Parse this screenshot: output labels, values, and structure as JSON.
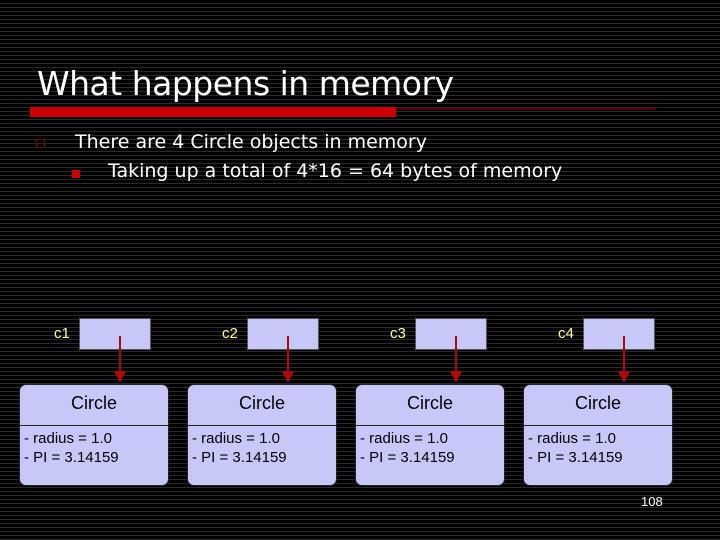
{
  "slide": {
    "title": "What happens in memory",
    "bullets": [
      {
        "level": 1,
        "text": "There are 4 Circle objects in memory"
      },
      {
        "level": 2,
        "text": "Taking up a total of 4*16 = 64 bytes of memory"
      }
    ],
    "page_number": "108"
  },
  "diagram": {
    "variables": [
      {
        "name": "c1",
        "points_to": "object 1"
      },
      {
        "name": "c2",
        "points_to": "object 2"
      },
      {
        "name": "c3",
        "points_to": "object 3"
      },
      {
        "name": "c4",
        "points_to": "object 4"
      }
    ],
    "objects": [
      {
        "class_name": "Circle",
        "fields": [
          "- radius = 1.0",
          "- PI = 3.14159"
        ]
      },
      {
        "class_name": "Circle",
        "fields": [
          "- radius = 1.0",
          "- PI = 3.14159"
        ]
      },
      {
        "class_name": "Circle",
        "fields": [
          "- radius = 1.0",
          "- PI = 3.14159"
        ]
      },
      {
        "class_name": "Circle",
        "fields": [
          "- radius = 1.0",
          "- PI = 3.14159"
        ]
      }
    ]
  },
  "colors": {
    "accent_red": "#cc0000",
    "box_fill": "#c8c8f8",
    "arrow": "#aa0a0a",
    "label_yellow": "#ffff99"
  }
}
